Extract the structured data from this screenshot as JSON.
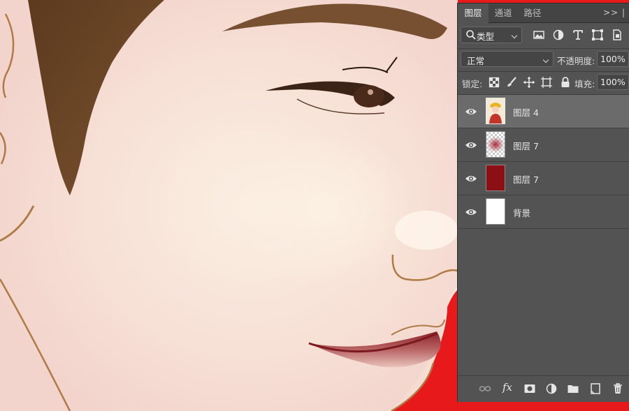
{
  "panel": {
    "tabs": [
      {
        "label": "图层",
        "active": true
      },
      {
        "label": "通道",
        "active": false
      },
      {
        "label": "路径",
        "active": false
      }
    ],
    "more_label": ">> |",
    "filter": {
      "label": "类型",
      "icon": "search-icon"
    },
    "filter_icons": [
      "image-filter-icon",
      "adjustment-filter-icon",
      "type-filter-icon",
      "shape-filter-icon",
      "smart-object-filter-icon"
    ],
    "blend_mode": "正常",
    "opacity_label": "不透明度:",
    "opacity_value": "100%",
    "lock_label": "锁定:",
    "lock_icons": [
      "lock-transparent-icon",
      "lock-image-icon",
      "lock-position-icon",
      "lock-artboard-icon",
      "lock-all-icon"
    ],
    "fill_label": "填充:",
    "fill_value": "100%",
    "layers": [
      {
        "name": "图层 4",
        "thumb": "figure",
        "selected": true
      },
      {
        "name": "图层 7",
        "thumb": "blush",
        "selected": false
      },
      {
        "name": "图层 7",
        "thumb": "dark-red",
        "selected": false
      },
      {
        "name": "背景",
        "thumb": "white",
        "selected": false
      }
    ],
    "bottom_icons": [
      "link-layers-icon",
      "fx-icon",
      "layer-mask-icon",
      "adjustment-layer-icon",
      "group-folder-icon",
      "new-layer-icon",
      "trash-icon"
    ],
    "fx_label": "fx"
  },
  "colors": {
    "panel_bg": "#535353",
    "selected_layer": "#6b6b6b",
    "canvas_red": "#e8191b",
    "skin": "#f6dcd3",
    "hair": "#6b4423",
    "lip": "#9e2a2a",
    "dark_red_layer": "#8b0f14"
  }
}
